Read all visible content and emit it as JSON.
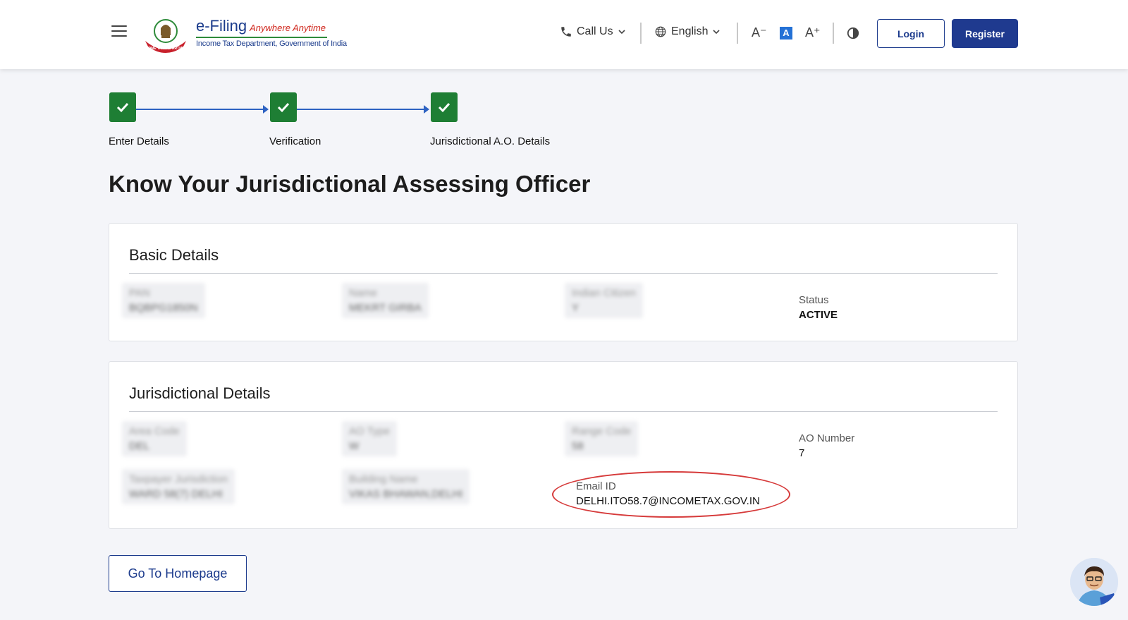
{
  "header": {
    "logo": {
      "main": "e-Filing",
      "tagline": "Anywhere Anytime",
      "sub": "Income Tax Department, Government of India",
      "emblem_text": "INCOME TAX DEPARTMENT"
    },
    "call_us": "Call Us",
    "language": "English",
    "font_controls": {
      "decrease": "A⁻",
      "default": "A",
      "increase": "A⁺"
    },
    "login_label": "Login",
    "register_label": "Register"
  },
  "stepper": {
    "steps": [
      {
        "label": "Enter Details",
        "status": "complete"
      },
      {
        "label": "Verification",
        "status": "complete"
      },
      {
        "label": "Jurisdictional A.O. Details",
        "status": "complete"
      }
    ]
  },
  "page_title": "Know Your Jurisdictional Assessing Officer",
  "basic_details": {
    "title": "Basic Details",
    "fields": [
      {
        "label": "PAN",
        "value": "BQBPG1850N",
        "blurred": true
      },
      {
        "label": "Name",
        "value": "MEKRT GIRBA",
        "blurred": true
      },
      {
        "label": "Indian Citizen",
        "value": "Y",
        "blurred": true
      },
      {
        "label": "Status",
        "value": "ACTIVE",
        "blurred": false
      }
    ]
  },
  "jurisdictional_details": {
    "title": "Jurisdictional Details",
    "fields": [
      {
        "label": "Area Code",
        "value": "DEL",
        "blurred": true
      },
      {
        "label": "AO Type",
        "value": "W",
        "blurred": true
      },
      {
        "label": "Range Code",
        "value": "58",
        "blurred": true
      },
      {
        "label": "AO Number",
        "value": "7",
        "blurred": false
      },
      {
        "label": "Taxpayer Jurisdiction",
        "value": "WARD 58(7) DELHI",
        "blurred": true
      },
      {
        "label": "Building Name",
        "value": "VIKAS BHAWAN,DELHI",
        "blurred": true
      },
      {
        "label": "Email ID",
        "value": "DELHI.ITO58.7@INCOMETAX.GOV.IN",
        "blurred": false,
        "highlighted": true
      }
    ]
  },
  "go_home_label": "Go To Homepage",
  "colors": {
    "primary": "#1f3a8f",
    "success": "#1e7e34",
    "highlight": "#d63a3a",
    "step_line": "#2d62c2"
  }
}
